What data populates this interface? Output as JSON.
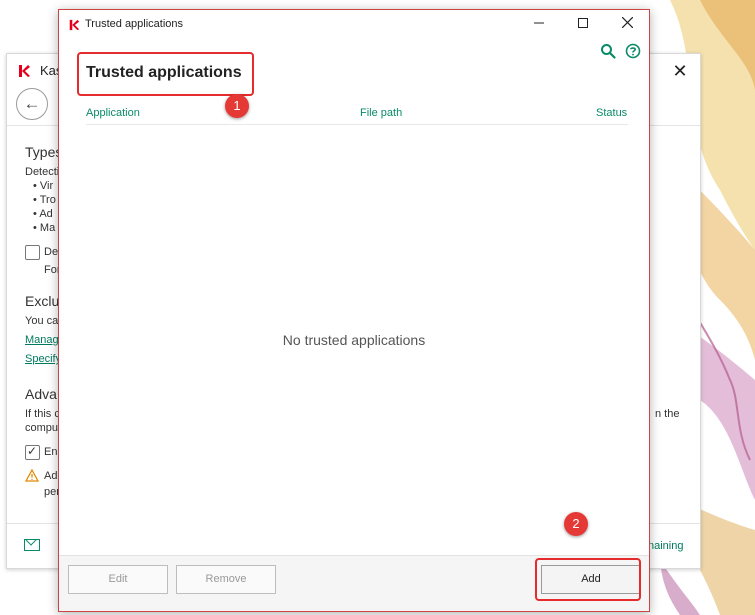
{
  "background_window": {
    "title": "Kas",
    "types_heading": "Types",
    "detect_label": "Detecti",
    "bullets": [
      "Vir",
      "Tro",
      "Ad",
      "Ma"
    ],
    "detect_other_label": "Det",
    "detect_other_sub": "For",
    "exclusions_heading": "Exclu",
    "exclusions_text": "You ca",
    "manage_link": "Manag",
    "specify_link": "Specify",
    "advanced_heading": "Adva",
    "advanced_text_left": "If this c",
    "advanced_text_right": "n the",
    "advanced_text_line2": "compu",
    "enable_label": "Ena",
    "enable_checked": true,
    "warning_line1": "Ad",
    "warning_line2": "per",
    "footer_right": "naining"
  },
  "dialog": {
    "window_title": "Trusted applications",
    "title": "Trusted applications",
    "columns": {
      "application": "Application",
      "file_path": "File path",
      "status": "Status"
    },
    "empty_message": "No trusted applications",
    "buttons": {
      "edit": "Edit",
      "remove": "Remove",
      "add": "Add"
    }
  },
  "callouts": {
    "one": "1",
    "two": "2"
  },
  "colors": {
    "accent_green": "#0a8a68",
    "highlight_red": "#e52b2b",
    "kaspersky_red": "#e4001b"
  }
}
